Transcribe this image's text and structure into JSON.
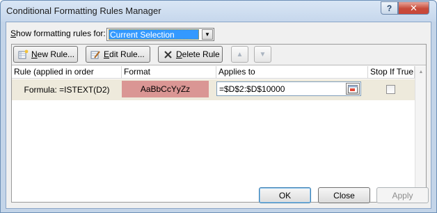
{
  "window": {
    "title": "Conditional Formatting Rules Manager",
    "help_label": "?",
    "close_label": "✕"
  },
  "scope": {
    "label_first": "S",
    "label_rest": "how formatting rules for:",
    "selected": "Current Selection"
  },
  "toolbar": {
    "new_rule_u": "N",
    "new_rule_rest": "ew Rule...",
    "edit_rule_u": "E",
    "edit_rule_rest": "dit Rule...",
    "delete_rule_u": "D",
    "delete_rule_rest": "elete Rule",
    "move_up_icon": "triangle-up-icon",
    "move_down_icon": "triangle-down-icon"
  },
  "table": {
    "headers": {
      "rule": "Rule (applied in order shown)",
      "format": "Format",
      "applies_to": "Applies to",
      "stop_if_true": "Stop If True"
    },
    "rows": [
      {
        "rule": "Formula: =ISTEXT(D2)",
        "format_preview": "AaBbCcYyZz",
        "format_fill": "#da9694",
        "applies_to": "=$D$2:$D$10000",
        "stop_if_true": false
      }
    ]
  },
  "footer": {
    "ok": "OK",
    "close": "Close",
    "apply": "Apply"
  },
  "colors": {
    "selected_row": "#eeeadc",
    "title_bar": "#c6d7ec",
    "close_button": "#c74b3a",
    "dropdown_highlight": "#3399ff"
  }
}
